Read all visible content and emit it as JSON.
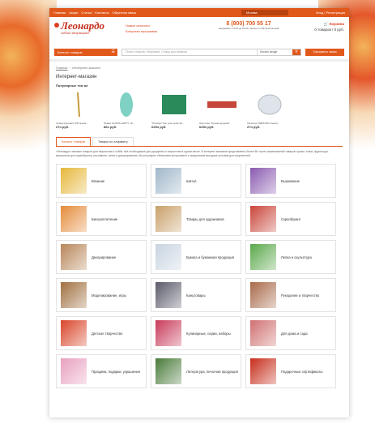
{
  "topbar": {
    "links": [
      "Главная",
      "Акции",
      "Статьи",
      "Контакты",
      "Обратная связь"
    ],
    "city": "Москва",
    "login": "Вход / Регистрация"
  },
  "header": {
    "logo_name": "Леонардо",
    "logo_tag": "хобби-гипермаркет",
    "promo_1": "Новые каталоги",
    "promo_2": "Бонусная программа",
    "phone": "8 (800) 700 55 17",
    "hours": "ежедневно с 9:00 до 21:00, звонок по РФ бесплатный",
    "cart_label": "Корзина",
    "cart_summary": "0 товаров / 0 руб."
  },
  "searchbar": {
    "catalog_label": "Каталог товаров",
    "placeholder": "Поиск товаров, Например: Спицы для вязания",
    "category": "Искать везде",
    "order_label": "Оформить заказ"
  },
  "breadcrumb": {
    "home": "Главная",
    "current": "Интернет-магазин"
  },
  "page_title": "Интернет-магазин",
  "popular_heading": "Популярные тем же",
  "products": [
    {
      "name": "Спица круговая ТИП алюм...",
      "price": "27н руб.",
      "color": "#c89b3c"
    },
    {
      "name": "Пряжа ALPINA HAPPY 10...",
      "price": "86н руб.",
      "color": "#7fd1c4"
    },
    {
      "name": "\"Пэчворк\" Кат для резки 30...",
      "price": "625н руб.",
      "color": "#2a8a5a"
    },
    {
      "name": "Ленточка \"Тесьма кружево\"",
      "price": "625н руб.",
      "color": "#c6463a"
    },
    {
      "name": "Палитра ТАВРИЧКА белая...",
      "price": "27н руб.",
      "color": "#dfe4ea"
    }
  ],
  "tabs": [
    "Каталог товаров",
    "Товары по алфавиту"
  ],
  "description": "«Леонардо» магазин товаров для творчества и хобби: всё необходимое для рукоделия и творчества в одном месте. В интернет-магазине представлены более 80 тысяч наименований товаров: пряжа, ткани, фурнитура, материалы для скрапбукинга, рисования, лепки и декорирования. Мы регулярно обновляем ассортимент и предлагаем выгодные условия для покупателей.",
  "categories": [
    {
      "name": "Вязание",
      "color": "#e6b73a"
    },
    {
      "name": "Шитьё",
      "color": "#9fb6c9"
    },
    {
      "name": "Вышивание",
      "color": "#8a5ab0"
    },
    {
      "name": "Бисероплетение",
      "color": "#e58b3a"
    },
    {
      "name": "Товары для художников",
      "color": "#c9a06a"
    },
    {
      "name": "Скрапбукинг",
      "color": "#c9453a"
    },
    {
      "name": "Декорирование",
      "color": "#b8865a"
    },
    {
      "name": "Бумага и бумажная продукция",
      "color": "#c8d4e0"
    },
    {
      "name": "Лепка и скульптура",
      "color": "#5aa84a"
    },
    {
      "name": "Моделирование, игры",
      "color": "#a07040"
    },
    {
      "name": "Канцтовары",
      "color": "#5a5a6a"
    },
    {
      "name": "Рукоделие и творчество",
      "color": "#a86a4a"
    },
    {
      "name": "Детское творчество",
      "color": "#d9452a"
    },
    {
      "name": "Кулинарные, серии, наборы",
      "color": "#c83a5a"
    },
    {
      "name": "Для дома и сада",
      "color": "#d07070"
    },
    {
      "name": "Праздник, подарки, украшения",
      "color": "#e8a0c0"
    },
    {
      "name": "Литература, печатная продукция",
      "color": "#4a7a3a"
    },
    {
      "name": "Подарочные сертификаты",
      "color": "#c62d1b"
    }
  ]
}
